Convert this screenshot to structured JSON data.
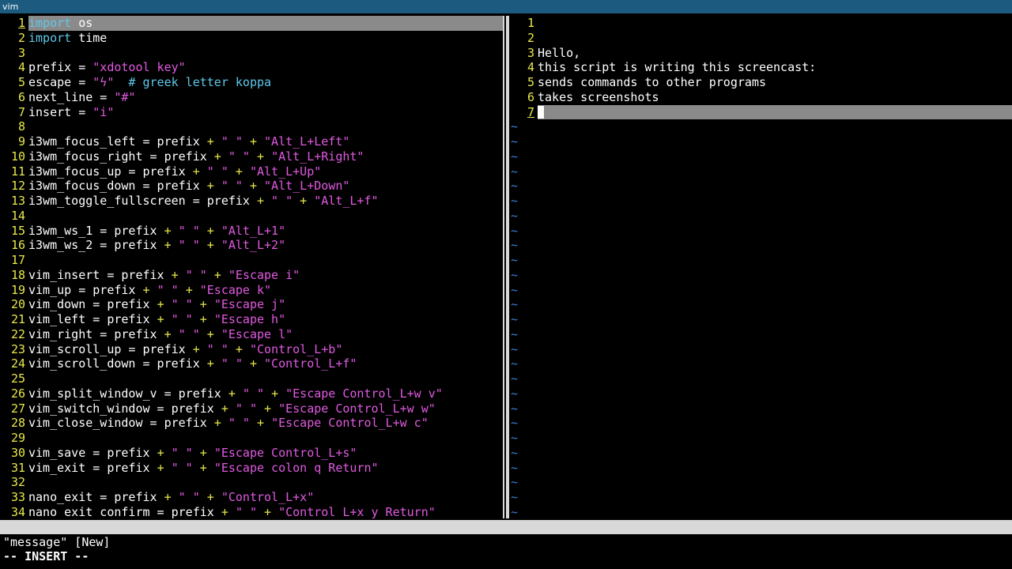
{
  "window": {
    "title": "vim"
  },
  "left_pane": {
    "lines": [
      {
        "n": "1",
        "tokens": [
          {
            "t": "import",
            "c": "kw"
          },
          {
            "t": " os",
            "c": "plain"
          }
        ]
      },
      {
        "n": "2",
        "tokens": [
          {
            "t": "import",
            "c": "kw"
          },
          {
            "t": " time",
            "c": "plain"
          }
        ]
      },
      {
        "n": "3",
        "tokens": []
      },
      {
        "n": "4",
        "tokens": [
          {
            "t": "prefix = ",
            "c": "plain"
          },
          {
            "t": "\"xdotool key\"",
            "c": "str"
          }
        ]
      },
      {
        "n": "5",
        "tokens": [
          {
            "t": "escape = ",
            "c": "plain"
          },
          {
            "t": "\"ϟ\"",
            "c": "str"
          },
          {
            "t": "  # greek letter koppa",
            "c": "cmt"
          }
        ]
      },
      {
        "n": "6",
        "tokens": [
          {
            "t": "next_line = ",
            "c": "plain"
          },
          {
            "t": "\"#\"",
            "c": "str"
          }
        ]
      },
      {
        "n": "7",
        "tokens": [
          {
            "t": "insert = ",
            "c": "plain"
          },
          {
            "t": "\"i\"",
            "c": "str"
          }
        ]
      },
      {
        "n": "8",
        "tokens": []
      },
      {
        "n": "9",
        "tokens": [
          {
            "t": "i3wm_focus_left = prefix ",
            "c": "plain"
          },
          {
            "t": "+",
            "c": "op"
          },
          {
            "t": " ",
            "c": "plain"
          },
          {
            "t": "\" \"",
            "c": "str"
          },
          {
            "t": " ",
            "c": "plain"
          },
          {
            "t": "+",
            "c": "op"
          },
          {
            "t": " ",
            "c": "plain"
          },
          {
            "t": "\"Alt_L+Left\"",
            "c": "str"
          }
        ]
      },
      {
        "n": "10",
        "tokens": [
          {
            "t": "i3wm_focus_right = prefix ",
            "c": "plain"
          },
          {
            "t": "+",
            "c": "op"
          },
          {
            "t": " ",
            "c": "plain"
          },
          {
            "t": "\" \"",
            "c": "str"
          },
          {
            "t": " ",
            "c": "plain"
          },
          {
            "t": "+",
            "c": "op"
          },
          {
            "t": " ",
            "c": "plain"
          },
          {
            "t": "\"Alt_L+Right\"",
            "c": "str"
          }
        ]
      },
      {
        "n": "11",
        "tokens": [
          {
            "t": "i3wm_focus_up = prefix ",
            "c": "plain"
          },
          {
            "t": "+",
            "c": "op"
          },
          {
            "t": " ",
            "c": "plain"
          },
          {
            "t": "\" \"",
            "c": "str"
          },
          {
            "t": " ",
            "c": "plain"
          },
          {
            "t": "+",
            "c": "op"
          },
          {
            "t": " ",
            "c": "plain"
          },
          {
            "t": "\"Alt_L+Up\"",
            "c": "str"
          }
        ]
      },
      {
        "n": "12",
        "tokens": [
          {
            "t": "i3wm_focus_down = prefix ",
            "c": "plain"
          },
          {
            "t": "+",
            "c": "op"
          },
          {
            "t": " ",
            "c": "plain"
          },
          {
            "t": "\" \"",
            "c": "str"
          },
          {
            "t": " ",
            "c": "plain"
          },
          {
            "t": "+",
            "c": "op"
          },
          {
            "t": " ",
            "c": "plain"
          },
          {
            "t": "\"Alt_L+Down\"",
            "c": "str"
          }
        ]
      },
      {
        "n": "13",
        "tokens": [
          {
            "t": "i3wm_toggle_fullscreen = prefix ",
            "c": "plain"
          },
          {
            "t": "+",
            "c": "op"
          },
          {
            "t": " ",
            "c": "plain"
          },
          {
            "t": "\" \"",
            "c": "str"
          },
          {
            "t": " ",
            "c": "plain"
          },
          {
            "t": "+",
            "c": "op"
          },
          {
            "t": " ",
            "c": "plain"
          },
          {
            "t": "\"Alt_L+f\"",
            "c": "str"
          }
        ]
      },
      {
        "n": "14",
        "tokens": []
      },
      {
        "n": "15",
        "tokens": [
          {
            "t": "i3wm_ws_1 = prefix ",
            "c": "plain"
          },
          {
            "t": "+",
            "c": "op"
          },
          {
            "t": " ",
            "c": "plain"
          },
          {
            "t": "\" \"",
            "c": "str"
          },
          {
            "t": " ",
            "c": "plain"
          },
          {
            "t": "+",
            "c": "op"
          },
          {
            "t": " ",
            "c": "plain"
          },
          {
            "t": "\"Alt_L+1\"",
            "c": "str"
          }
        ]
      },
      {
        "n": "16",
        "tokens": [
          {
            "t": "i3wm_ws_2 = prefix ",
            "c": "plain"
          },
          {
            "t": "+",
            "c": "op"
          },
          {
            "t": " ",
            "c": "plain"
          },
          {
            "t": "\" \"",
            "c": "str"
          },
          {
            "t": " ",
            "c": "plain"
          },
          {
            "t": "+",
            "c": "op"
          },
          {
            "t": " ",
            "c": "plain"
          },
          {
            "t": "\"Alt_L+2\"",
            "c": "str"
          }
        ]
      },
      {
        "n": "17",
        "tokens": []
      },
      {
        "n": "18",
        "tokens": [
          {
            "t": "vim_insert = prefix ",
            "c": "plain"
          },
          {
            "t": "+",
            "c": "op"
          },
          {
            "t": " ",
            "c": "plain"
          },
          {
            "t": "\" \"",
            "c": "str"
          },
          {
            "t": " ",
            "c": "plain"
          },
          {
            "t": "+",
            "c": "op"
          },
          {
            "t": " ",
            "c": "plain"
          },
          {
            "t": "\"Escape i\"",
            "c": "str"
          }
        ]
      },
      {
        "n": "19",
        "tokens": [
          {
            "t": "vim_up = prefix ",
            "c": "plain"
          },
          {
            "t": "+",
            "c": "op"
          },
          {
            "t": " ",
            "c": "plain"
          },
          {
            "t": "\" \"",
            "c": "str"
          },
          {
            "t": " ",
            "c": "plain"
          },
          {
            "t": "+",
            "c": "op"
          },
          {
            "t": " ",
            "c": "plain"
          },
          {
            "t": "\"Escape k\"",
            "c": "str"
          }
        ]
      },
      {
        "n": "20",
        "tokens": [
          {
            "t": "vim_down = prefix ",
            "c": "plain"
          },
          {
            "t": "+",
            "c": "op"
          },
          {
            "t": " ",
            "c": "plain"
          },
          {
            "t": "\" \"",
            "c": "str"
          },
          {
            "t": " ",
            "c": "plain"
          },
          {
            "t": "+",
            "c": "op"
          },
          {
            "t": " ",
            "c": "plain"
          },
          {
            "t": "\"Escape j\"",
            "c": "str"
          }
        ]
      },
      {
        "n": "21",
        "tokens": [
          {
            "t": "vim_left = prefix ",
            "c": "plain"
          },
          {
            "t": "+",
            "c": "op"
          },
          {
            "t": " ",
            "c": "plain"
          },
          {
            "t": "\" \"",
            "c": "str"
          },
          {
            "t": " ",
            "c": "plain"
          },
          {
            "t": "+",
            "c": "op"
          },
          {
            "t": " ",
            "c": "plain"
          },
          {
            "t": "\"Escape h\"",
            "c": "str"
          }
        ]
      },
      {
        "n": "22",
        "tokens": [
          {
            "t": "vim_right = prefix ",
            "c": "plain"
          },
          {
            "t": "+",
            "c": "op"
          },
          {
            "t": " ",
            "c": "plain"
          },
          {
            "t": "\" \"",
            "c": "str"
          },
          {
            "t": " ",
            "c": "plain"
          },
          {
            "t": "+",
            "c": "op"
          },
          {
            "t": " ",
            "c": "plain"
          },
          {
            "t": "\"Escape l\"",
            "c": "str"
          }
        ]
      },
      {
        "n": "23",
        "tokens": [
          {
            "t": "vim_scroll_up = prefix ",
            "c": "plain"
          },
          {
            "t": "+",
            "c": "op"
          },
          {
            "t": " ",
            "c": "plain"
          },
          {
            "t": "\" \"",
            "c": "str"
          },
          {
            "t": " ",
            "c": "plain"
          },
          {
            "t": "+",
            "c": "op"
          },
          {
            "t": " ",
            "c": "plain"
          },
          {
            "t": "\"Control_L+b\"",
            "c": "str"
          }
        ]
      },
      {
        "n": "24",
        "tokens": [
          {
            "t": "vim_scroll_down = prefix ",
            "c": "plain"
          },
          {
            "t": "+",
            "c": "op"
          },
          {
            "t": " ",
            "c": "plain"
          },
          {
            "t": "\" \"",
            "c": "str"
          },
          {
            "t": " ",
            "c": "plain"
          },
          {
            "t": "+",
            "c": "op"
          },
          {
            "t": " ",
            "c": "plain"
          },
          {
            "t": "\"Control_L+f\"",
            "c": "str"
          }
        ]
      },
      {
        "n": "25",
        "tokens": []
      },
      {
        "n": "26",
        "tokens": [
          {
            "t": "vim_split_window_v = prefix ",
            "c": "plain"
          },
          {
            "t": "+",
            "c": "op"
          },
          {
            "t": " ",
            "c": "plain"
          },
          {
            "t": "\" \"",
            "c": "str"
          },
          {
            "t": " ",
            "c": "plain"
          },
          {
            "t": "+",
            "c": "op"
          },
          {
            "t": " ",
            "c": "plain"
          },
          {
            "t": "\"Escape Control_L+w v\"",
            "c": "str"
          }
        ]
      },
      {
        "n": "27",
        "tokens": [
          {
            "t": "vim_switch_window = prefix ",
            "c": "plain"
          },
          {
            "t": "+",
            "c": "op"
          },
          {
            "t": " ",
            "c": "plain"
          },
          {
            "t": "\" \"",
            "c": "str"
          },
          {
            "t": " ",
            "c": "plain"
          },
          {
            "t": "+",
            "c": "op"
          },
          {
            "t": " ",
            "c": "plain"
          },
          {
            "t": "\"Escape Control_L+w w\"",
            "c": "str"
          }
        ]
      },
      {
        "n": "28",
        "tokens": [
          {
            "t": "vim_close_window = prefix ",
            "c": "plain"
          },
          {
            "t": "+",
            "c": "op"
          },
          {
            "t": " ",
            "c": "plain"
          },
          {
            "t": "\" \"",
            "c": "str"
          },
          {
            "t": " ",
            "c": "plain"
          },
          {
            "t": "+",
            "c": "op"
          },
          {
            "t": " ",
            "c": "plain"
          },
          {
            "t": "\"Escape Control_L+w c\"",
            "c": "str"
          }
        ]
      },
      {
        "n": "29",
        "tokens": []
      },
      {
        "n": "30",
        "tokens": [
          {
            "t": "vim_save = prefix ",
            "c": "plain"
          },
          {
            "t": "+",
            "c": "op"
          },
          {
            "t": " ",
            "c": "plain"
          },
          {
            "t": "\" \"",
            "c": "str"
          },
          {
            "t": " ",
            "c": "plain"
          },
          {
            "t": "+",
            "c": "op"
          },
          {
            "t": " ",
            "c": "plain"
          },
          {
            "t": "\"Escape Control_L+s\"",
            "c": "str"
          }
        ]
      },
      {
        "n": "31",
        "tokens": [
          {
            "t": "vim_exit = prefix ",
            "c": "plain"
          },
          {
            "t": "+",
            "c": "op"
          },
          {
            "t": " ",
            "c": "plain"
          },
          {
            "t": "\" \"",
            "c": "str"
          },
          {
            "t": " ",
            "c": "plain"
          },
          {
            "t": "+",
            "c": "op"
          },
          {
            "t": " ",
            "c": "plain"
          },
          {
            "t": "\"Escape colon q Return\"",
            "c": "str"
          }
        ]
      },
      {
        "n": "32",
        "tokens": []
      },
      {
        "n": "33",
        "tokens": [
          {
            "t": "nano_exit = prefix ",
            "c": "plain"
          },
          {
            "t": "+",
            "c": "op"
          },
          {
            "t": " ",
            "c": "plain"
          },
          {
            "t": "\" \"",
            "c": "str"
          },
          {
            "t": " ",
            "c": "plain"
          },
          {
            "t": "+",
            "c": "op"
          },
          {
            "t": " ",
            "c": "plain"
          },
          {
            "t": "\"Control_L+x\"",
            "c": "str"
          }
        ]
      },
      {
        "n": "34",
        "tokens": [
          {
            "t": "nano_exit_confirm = prefix ",
            "c": "plain"
          },
          {
            "t": "+",
            "c": "op"
          },
          {
            "t": " ",
            "c": "plain"
          },
          {
            "t": "\" \"",
            "c": "str"
          },
          {
            "t": " ",
            "c": "plain"
          },
          {
            "t": "+",
            "c": "op"
          },
          {
            "t": " ",
            "c": "plain"
          },
          {
            "t": "\"Control_L+x y Return\"",
            "c": "str"
          }
        ]
      }
    ]
  },
  "right_pane": {
    "lines": [
      {
        "n": "1",
        "text": ""
      },
      {
        "n": "2",
        "text": ""
      },
      {
        "n": "3",
        "text": "Hello,"
      },
      {
        "n": "4",
        "text": "this script is writing this screencast:"
      },
      {
        "n": "5",
        "text": "sends commands to other programs"
      },
      {
        "n": "6",
        "text": "takes screenshots"
      },
      {
        "n": "7",
        "text": "",
        "cursor": true
      }
    ],
    "tilde": "~",
    "tilde_count": 27
  },
  "message_line": "\"message\" [New]",
  "mode_line": "-- INSERT --",
  "colors": {
    "line_number": "#e8e84a",
    "keyword": "#5ec8ea",
    "string": "#e05ae0",
    "tilde": "#3e7fd6",
    "cursorline": "#8a8a8a",
    "titlebar": "#1c5a80"
  }
}
